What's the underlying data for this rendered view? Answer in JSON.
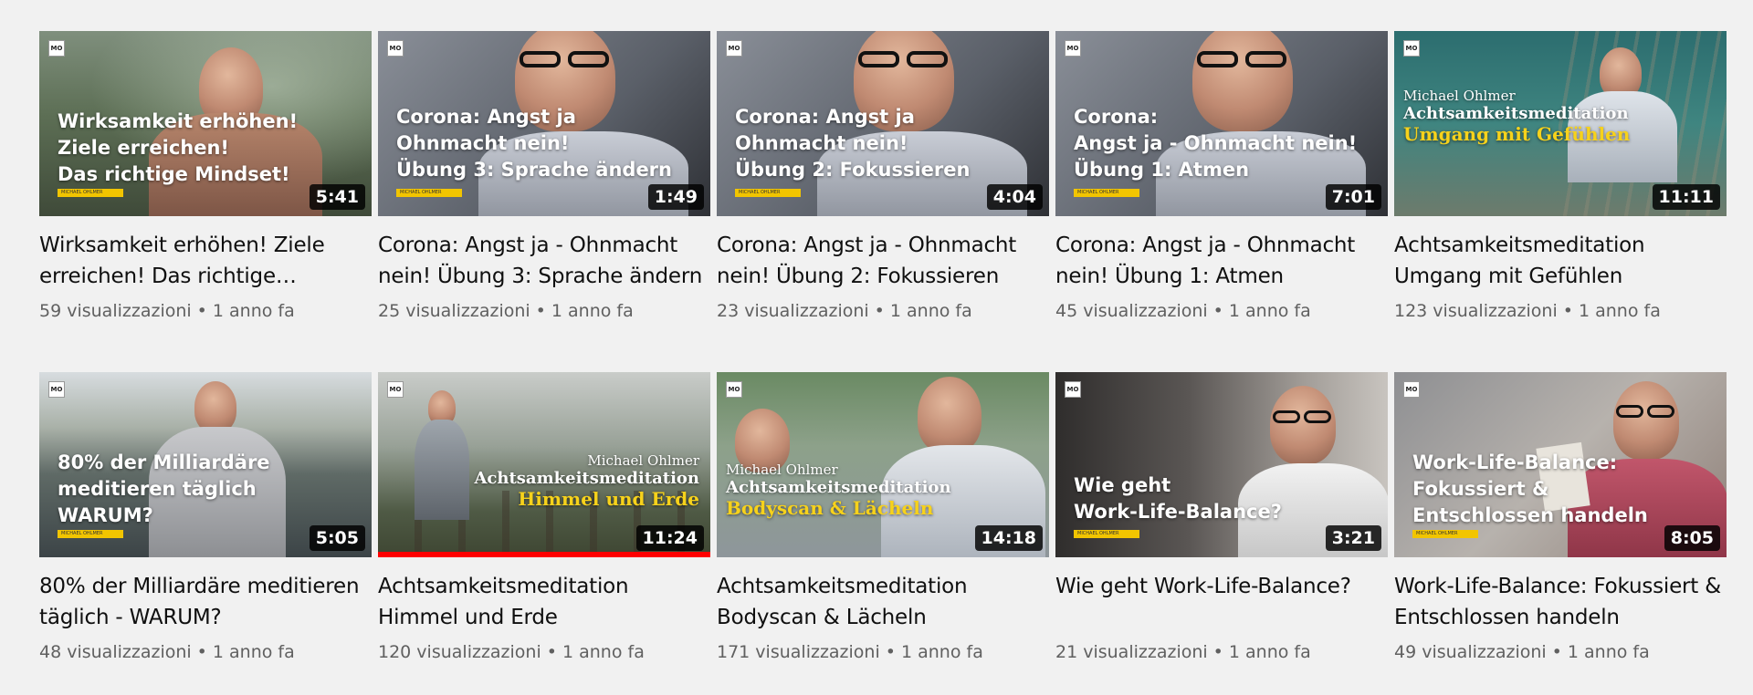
{
  "channel_logo": "MO",
  "brand_tag": "MICHAEL OHLMER",
  "videos": [
    {
      "title": "Wirksamkeit erhöhen! Ziele erreichen! Das richtige Mindset!",
      "duration": "5:41",
      "views": "59 visualizzazioni",
      "age": "1 anno fa",
      "overlay": "Wirksamkeit erhöhen!\nZiele erreichen!\nDas richtige Mindset!",
      "watched_fraction": 0
    },
    {
      "title": "Corona: Angst ja - Ohnmacht nein! Übung 3: Sprache ändern",
      "duration": "1:49",
      "views": "25 visualizzazioni",
      "age": "1 anno fa",
      "overlay": "Corona: Angst ja\nOhnmacht nein!\nÜbung 3: Sprache ändern",
      "watched_fraction": 0
    },
    {
      "title": "Corona: Angst ja - Ohnmacht nein! Übung 2: Fokussieren",
      "duration": "4:04",
      "views": "23 visualizzazioni",
      "age": "1 anno fa",
      "overlay": "Corona: Angst ja\nOhnmacht nein!\nÜbung 2: Fokussieren",
      "watched_fraction": 0
    },
    {
      "title": "Corona: Angst ja - Ohnmacht nein! Übung 1: Atmen",
      "duration": "7:01",
      "views": "45 visualizzazioni",
      "age": "1 anno fa",
      "overlay": "Corona:\nAngst ja - Ohnmacht nein!\nÜbung 1: Atmen",
      "watched_fraction": 0
    },
    {
      "title": "Achtsamkeitsmeditation Umgang mit Gefühlen",
      "duration": "11:11",
      "views": "123 visualizzazioni",
      "age": "1 anno fa",
      "overlay_name": "Michael Ohlmer",
      "overlay_main": "Achtsamkeitsmeditation",
      "overlay_sub": "Umgang mit Gefühlen",
      "watched_fraction": 0
    },
    {
      "title": "80% der Milliardäre meditieren täglich - WARUM?",
      "duration": "5:05",
      "views": "48 visualizzazioni",
      "age": "1 anno fa",
      "overlay": "80% der Milliardäre\nmeditieren täglich\nWARUM?",
      "watched_fraction": 0
    },
    {
      "title": "Achtsamkeitsmeditation Himmel und Erde",
      "duration": "11:24",
      "views": "120 visualizzazioni",
      "age": "1 anno fa",
      "overlay_name": "Michael Ohlmer",
      "overlay_main": "Achtsamkeitsmeditation",
      "overlay_sub": "Himmel und Erde",
      "watched_fraction": 1
    },
    {
      "title": "Achtsamkeitsmeditation Bodyscan & Lächeln",
      "duration": "14:18",
      "views": "171 visualizzazioni",
      "age": "1 anno fa",
      "overlay_name": "Michael Ohlmer",
      "overlay_main": "Achtsamkeitsmeditation",
      "overlay_sub": "Bodyscan & Lächeln",
      "watched_fraction": 0
    },
    {
      "title": "Wie geht Work-Life-Balance?",
      "duration": "3:21",
      "views": "21 visualizzazioni",
      "age": "1 anno fa",
      "overlay": "Wie geht\nWork-Life-Balance?",
      "watched_fraction": 0
    },
    {
      "title": "Work-Life-Balance: Fokussiert & Entschlossen handeln",
      "duration": "8:05",
      "views": "49 visualizzazioni",
      "age": "1 anno fa",
      "overlay": "Work-Life-Balance:\nFokussiert &\nEntschlossen handeln",
      "watched_fraction": 0
    }
  ],
  "colors": {
    "background": "#f1f1f1",
    "progress": "#ff0000",
    "accent_yellow": "#f7d21b"
  }
}
